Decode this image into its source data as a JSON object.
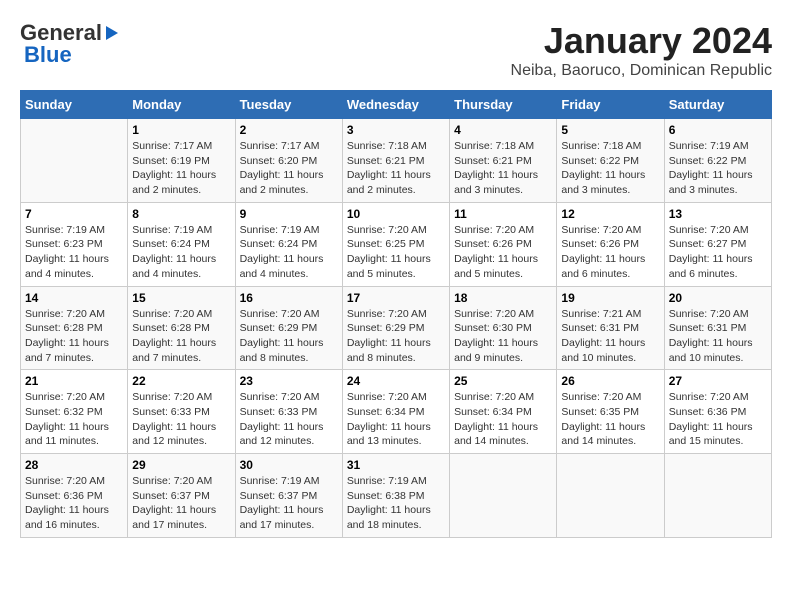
{
  "logo": {
    "general": "General",
    "blue": "Blue",
    "arrow": "►"
  },
  "title": "January 2024",
  "subtitle": "Neiba, Baoruco, Dominican Republic",
  "days_of_week": [
    "Sunday",
    "Monday",
    "Tuesday",
    "Wednesday",
    "Thursday",
    "Friday",
    "Saturday"
  ],
  "weeks": [
    [
      {
        "day": "",
        "sunrise": "",
        "sunset": "",
        "daylight": ""
      },
      {
        "day": "1",
        "sunrise": "Sunrise: 7:17 AM",
        "sunset": "Sunset: 6:19 PM",
        "daylight": "Daylight: 11 hours and 2 minutes."
      },
      {
        "day": "2",
        "sunrise": "Sunrise: 7:17 AM",
        "sunset": "Sunset: 6:20 PM",
        "daylight": "Daylight: 11 hours and 2 minutes."
      },
      {
        "day": "3",
        "sunrise": "Sunrise: 7:18 AM",
        "sunset": "Sunset: 6:21 PM",
        "daylight": "Daylight: 11 hours and 2 minutes."
      },
      {
        "day": "4",
        "sunrise": "Sunrise: 7:18 AM",
        "sunset": "Sunset: 6:21 PM",
        "daylight": "Daylight: 11 hours and 3 minutes."
      },
      {
        "day": "5",
        "sunrise": "Sunrise: 7:18 AM",
        "sunset": "Sunset: 6:22 PM",
        "daylight": "Daylight: 11 hours and 3 minutes."
      },
      {
        "day": "6",
        "sunrise": "Sunrise: 7:19 AM",
        "sunset": "Sunset: 6:22 PM",
        "daylight": "Daylight: 11 hours and 3 minutes."
      }
    ],
    [
      {
        "day": "7",
        "sunrise": "Sunrise: 7:19 AM",
        "sunset": "Sunset: 6:23 PM",
        "daylight": "Daylight: 11 hours and 4 minutes."
      },
      {
        "day": "8",
        "sunrise": "Sunrise: 7:19 AM",
        "sunset": "Sunset: 6:24 PM",
        "daylight": "Daylight: 11 hours and 4 minutes."
      },
      {
        "day": "9",
        "sunrise": "Sunrise: 7:19 AM",
        "sunset": "Sunset: 6:24 PM",
        "daylight": "Daylight: 11 hours and 4 minutes."
      },
      {
        "day": "10",
        "sunrise": "Sunrise: 7:20 AM",
        "sunset": "Sunset: 6:25 PM",
        "daylight": "Daylight: 11 hours and 5 minutes."
      },
      {
        "day": "11",
        "sunrise": "Sunrise: 7:20 AM",
        "sunset": "Sunset: 6:26 PM",
        "daylight": "Daylight: 11 hours and 5 minutes."
      },
      {
        "day": "12",
        "sunrise": "Sunrise: 7:20 AM",
        "sunset": "Sunset: 6:26 PM",
        "daylight": "Daylight: 11 hours and 6 minutes."
      },
      {
        "day": "13",
        "sunrise": "Sunrise: 7:20 AM",
        "sunset": "Sunset: 6:27 PM",
        "daylight": "Daylight: 11 hours and 6 minutes."
      }
    ],
    [
      {
        "day": "14",
        "sunrise": "Sunrise: 7:20 AM",
        "sunset": "Sunset: 6:28 PM",
        "daylight": "Daylight: 11 hours and 7 minutes."
      },
      {
        "day": "15",
        "sunrise": "Sunrise: 7:20 AM",
        "sunset": "Sunset: 6:28 PM",
        "daylight": "Daylight: 11 hours and 7 minutes."
      },
      {
        "day": "16",
        "sunrise": "Sunrise: 7:20 AM",
        "sunset": "Sunset: 6:29 PM",
        "daylight": "Daylight: 11 hours and 8 minutes."
      },
      {
        "day": "17",
        "sunrise": "Sunrise: 7:20 AM",
        "sunset": "Sunset: 6:29 PM",
        "daylight": "Daylight: 11 hours and 8 minutes."
      },
      {
        "day": "18",
        "sunrise": "Sunrise: 7:20 AM",
        "sunset": "Sunset: 6:30 PM",
        "daylight": "Daylight: 11 hours and 9 minutes."
      },
      {
        "day": "19",
        "sunrise": "Sunrise: 7:21 AM",
        "sunset": "Sunset: 6:31 PM",
        "daylight": "Daylight: 11 hours and 10 minutes."
      },
      {
        "day": "20",
        "sunrise": "Sunrise: 7:20 AM",
        "sunset": "Sunset: 6:31 PM",
        "daylight": "Daylight: 11 hours and 10 minutes."
      }
    ],
    [
      {
        "day": "21",
        "sunrise": "Sunrise: 7:20 AM",
        "sunset": "Sunset: 6:32 PM",
        "daylight": "Daylight: 11 hours and 11 minutes."
      },
      {
        "day": "22",
        "sunrise": "Sunrise: 7:20 AM",
        "sunset": "Sunset: 6:33 PM",
        "daylight": "Daylight: 11 hours and 12 minutes."
      },
      {
        "day": "23",
        "sunrise": "Sunrise: 7:20 AM",
        "sunset": "Sunset: 6:33 PM",
        "daylight": "Daylight: 11 hours and 12 minutes."
      },
      {
        "day": "24",
        "sunrise": "Sunrise: 7:20 AM",
        "sunset": "Sunset: 6:34 PM",
        "daylight": "Daylight: 11 hours and 13 minutes."
      },
      {
        "day": "25",
        "sunrise": "Sunrise: 7:20 AM",
        "sunset": "Sunset: 6:34 PM",
        "daylight": "Daylight: 11 hours and 14 minutes."
      },
      {
        "day": "26",
        "sunrise": "Sunrise: 7:20 AM",
        "sunset": "Sunset: 6:35 PM",
        "daylight": "Daylight: 11 hours and 14 minutes."
      },
      {
        "day": "27",
        "sunrise": "Sunrise: 7:20 AM",
        "sunset": "Sunset: 6:36 PM",
        "daylight": "Daylight: 11 hours and 15 minutes."
      }
    ],
    [
      {
        "day": "28",
        "sunrise": "Sunrise: 7:20 AM",
        "sunset": "Sunset: 6:36 PM",
        "daylight": "Daylight: 11 hours and 16 minutes."
      },
      {
        "day": "29",
        "sunrise": "Sunrise: 7:20 AM",
        "sunset": "Sunset: 6:37 PM",
        "daylight": "Daylight: 11 hours and 17 minutes."
      },
      {
        "day": "30",
        "sunrise": "Sunrise: 7:19 AM",
        "sunset": "Sunset: 6:37 PM",
        "daylight": "Daylight: 11 hours and 17 minutes."
      },
      {
        "day": "31",
        "sunrise": "Sunrise: 7:19 AM",
        "sunset": "Sunset: 6:38 PM",
        "daylight": "Daylight: 11 hours and 18 minutes."
      },
      {
        "day": "",
        "sunrise": "",
        "sunset": "",
        "daylight": ""
      },
      {
        "day": "",
        "sunrise": "",
        "sunset": "",
        "daylight": ""
      },
      {
        "day": "",
        "sunrise": "",
        "sunset": "",
        "daylight": ""
      }
    ]
  ]
}
